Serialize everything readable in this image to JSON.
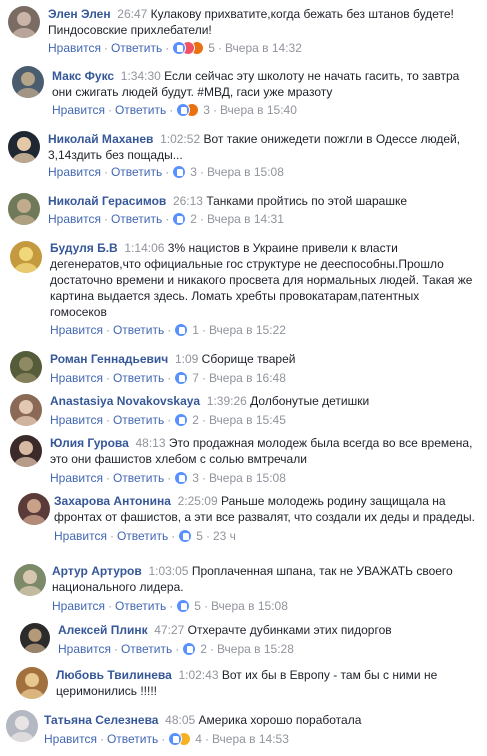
{
  "labels": {
    "like": "Нравится",
    "reply": "Ответить",
    "sep": "·"
  },
  "comments": [
    {
      "author": "Элен Элен",
      "time": "26:47",
      "text": "Кулакову прихватите,когда бежать без штанов будете! Пиндосовские прихлебатели!",
      "count": "5",
      "date": "Вчера в 14:32",
      "reactions": [
        "like",
        "love",
        "angry"
      ]
    },
    {
      "author": "Макс Фукс",
      "time": "1:34:30",
      "text": "Если сейчас эту школоту не начать гасить, то завтра они сжигать людей будут. #МВД, гаси уже мразоту",
      "count": "3",
      "date": "Вчера в 15:40",
      "reactions": [
        "like",
        "angry"
      ]
    },
    {
      "author": "Николай Маханев",
      "time": "1:02:52",
      "text": "Вот такие онижедети пожгли в Одессе людей, 3,14здить без пощады...",
      "count": "3",
      "date": "Вчера в 15:08",
      "reactions": [
        "like"
      ]
    },
    {
      "author": "Николай Герасимов",
      "time": "26:13",
      "text": "Танками пройтись по этой шарашке",
      "count": "2",
      "date": "Вчера в 14:31",
      "reactions": [
        "like"
      ]
    },
    {
      "author": "Будуля Б.В",
      "time": "1:14:06",
      "text": "3% нацистов в Украине привели к власти дегенератов,что официальные гос структуре не дееспособны.Прошло достаточно времени и никакого просвета для нормальных людей. Такая же картина выдается здесь. Ломать хребты провокатарам,патентных гомосеков",
      "count": "1",
      "date": "Вчера в 15:22",
      "reactions": [
        "like"
      ]
    },
    {
      "author": "Роман Геннадьевич",
      "time": "1:09",
      "text": "Сборище тварей",
      "count": "7",
      "date": "Вчера в 16:48",
      "reactions": [
        "like"
      ]
    },
    {
      "author": "Anastasiya Novakovskaya",
      "time": "1:39:26",
      "text": "Долбонутые детишки",
      "count": "2",
      "date": "Вчера в 15:45",
      "reactions": [
        "like"
      ]
    },
    {
      "author": "Юлия Гурова",
      "time": "48:13",
      "text": "Это продажная молодеж была всегда во все времена, это они фашистов хлебом с солью вмтречали",
      "count": "3",
      "date": "Вчера в 15:08",
      "reactions": [
        "like"
      ]
    },
    {
      "author": "Захарова Антонина",
      "time": "2:25:09",
      "text": "Раньше молодежь родину защищала на фронтах от фашистов, а эти все развалят, что создали их деды и прадеды.",
      "count": "5",
      "date": "23 ч",
      "reactions": [
        "like"
      ]
    },
    {
      "author": "Артур Артуров",
      "time": "1:03:05",
      "text": "Проплаченная шпана, так не УВАЖАТЬ своего национального лидера.",
      "count": "5",
      "date": "Вчера в 15:08",
      "reactions": [
        "like"
      ]
    },
    {
      "author": "Алексей Плинк",
      "time": "47:27",
      "text": "Отхерачте дубинками этих пидоргов",
      "count": "2",
      "date": "Вчера в 15:28",
      "reactions": [
        "like"
      ]
    },
    {
      "author": "Любовь Твилинева",
      "time": "1:02:43",
      "text": "Вот их бы в Европу - там бы с ними не церимонились !!!!!",
      "count": "",
      "date": "",
      "reactions": []
    },
    {
      "author": "Татьяна Селезнева",
      "time": "48:05",
      "text": "Америка хорошо поработала",
      "count": "4",
      "date": "Вчера в 14:53",
      "reactions": [
        "like",
        "wow"
      ]
    }
  ],
  "colors": {
    "author": "#365899",
    "link": "#4267b2",
    "muted": "#90949c",
    "text": "#1d2129",
    "like": "#5890ff"
  }
}
